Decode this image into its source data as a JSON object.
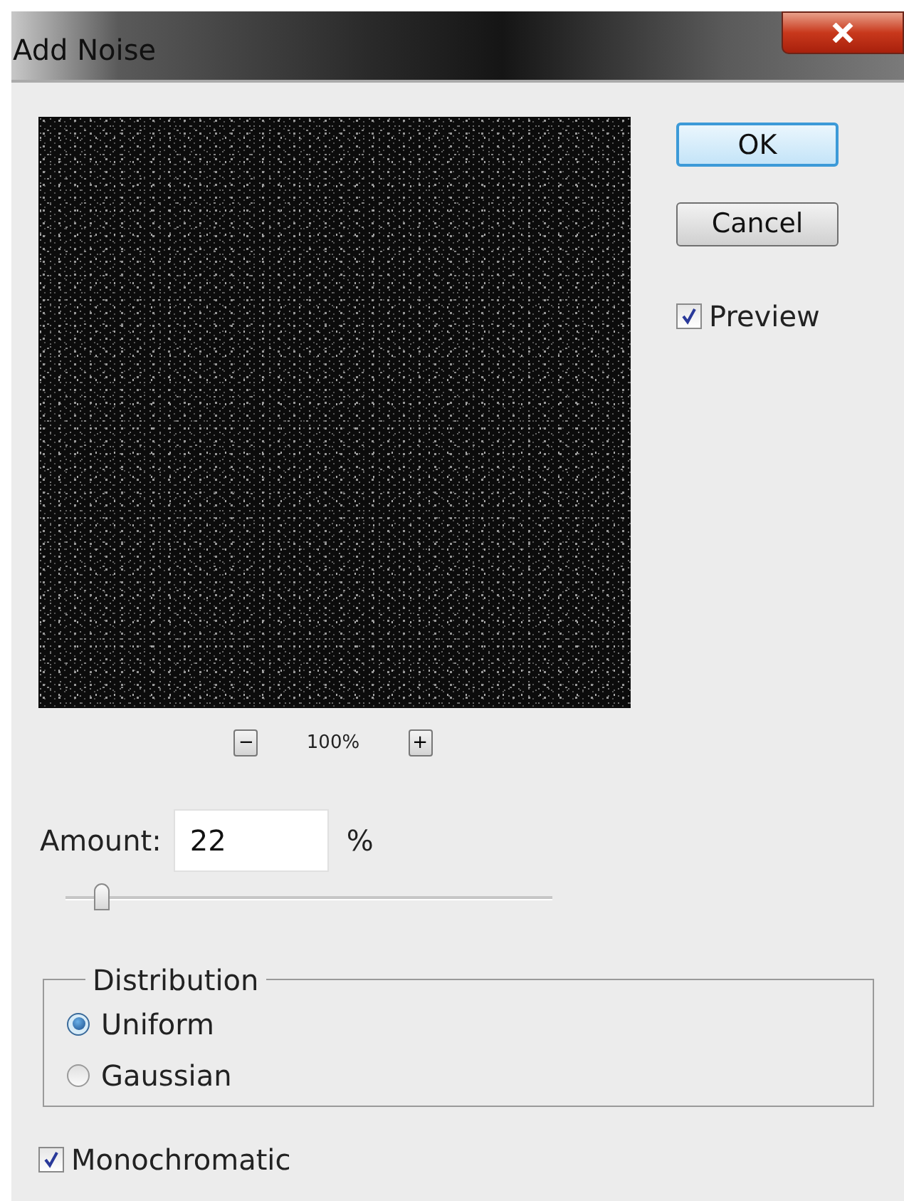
{
  "window": {
    "title": "Add Noise"
  },
  "buttons": [
    {
      "label": "OK",
      "default": true
    },
    {
      "label": "Cancel",
      "default": false
    }
  ],
  "preview": {
    "label": "Preview",
    "checked": true
  },
  "zoom": {
    "minus": "−",
    "value": "100%",
    "plus": "+"
  },
  "amount": {
    "label": "Amount:",
    "value": "22",
    "unit": "%",
    "level": 0.06
  },
  "distribution": {
    "legend": "Distribution",
    "options": [
      {
        "label": "Uniform",
        "selected": true
      },
      {
        "label": "Gaussian",
        "selected": false
      }
    ]
  },
  "monochromatic": {
    "label": "Monochromatic",
    "checked": true
  }
}
